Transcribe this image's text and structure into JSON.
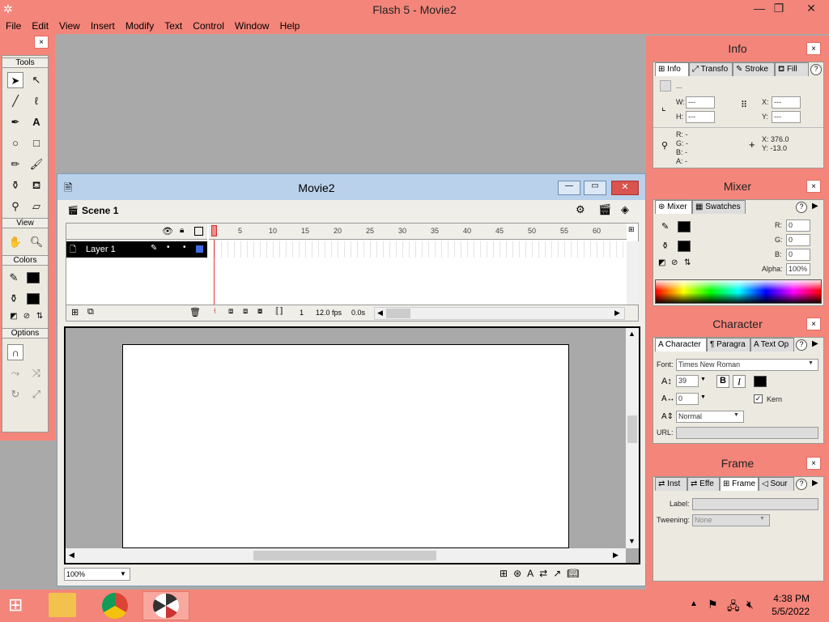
{
  "window": {
    "title": "Flash 5 - Movie2",
    "logo_icon": "flash-logo-icon"
  },
  "menu": [
    "File",
    "Edit",
    "View",
    "Insert",
    "Modify",
    "Text",
    "Control",
    "Window",
    "Help"
  ],
  "tools_panel": {
    "close": "×",
    "tools_label": "Tools",
    "view_label": "View",
    "colors_label": "Colors",
    "options_label": "Options"
  },
  "movie": {
    "title": "Movie2",
    "scene": "Scene 1",
    "layer": "Layer 1",
    "frame_ticks": [
      "5",
      "10",
      "15",
      "20",
      "25",
      "30",
      "35",
      "40",
      "45",
      "50",
      "55",
      "60"
    ],
    "current_frame": "1",
    "fps": "12.0 fps",
    "time": "0.0s",
    "zoom": "100%"
  },
  "info_panel": {
    "title": "Info",
    "tabs": [
      "Info",
      "Transfo",
      "Stroke",
      "Fill"
    ],
    "help": "?",
    "instance": "...",
    "w_label": "W:",
    "w_value": "---",
    "h_label": "H:",
    "h_value": "---",
    "x_label": "X:",
    "x_value": "---",
    "y_label": "Y:",
    "y_value": "---",
    "r": "R: -",
    "g": "G: -",
    "b": "B: -",
    "a": "A: -",
    "cursor_x": "X:  376.0",
    "cursor_y": "Y:  -13.0"
  },
  "mixer_panel": {
    "title": "Mixer",
    "tabs": [
      "Mixer",
      "Swatches"
    ],
    "r_label": "R:",
    "r_value": "0",
    "g_label": "G:",
    "g_value": "0",
    "b_label": "B:",
    "b_value": "0",
    "alpha_label": "Alpha:",
    "alpha_value": "100%"
  },
  "character_panel": {
    "title": "Character",
    "tabs": [
      "Character",
      "Paragra",
      "Text Op"
    ],
    "font_label": "Font:",
    "font_value": "Times New Roman",
    "size_value": "39",
    "tracking_value": "0",
    "bold": "B",
    "italic": "I",
    "kern_label": "Kern",
    "baseline_value": "Normal",
    "url_label": "URL:"
  },
  "frame_panel": {
    "title": "Frame",
    "tabs": [
      "Inst",
      "Effe",
      "Frame",
      "Sour"
    ],
    "label_label": "Label:",
    "tweening_label": "Tweening:",
    "tweening_value": "None"
  },
  "taskbar": {
    "time": "4:38 PM",
    "date": "5/5/2022"
  }
}
